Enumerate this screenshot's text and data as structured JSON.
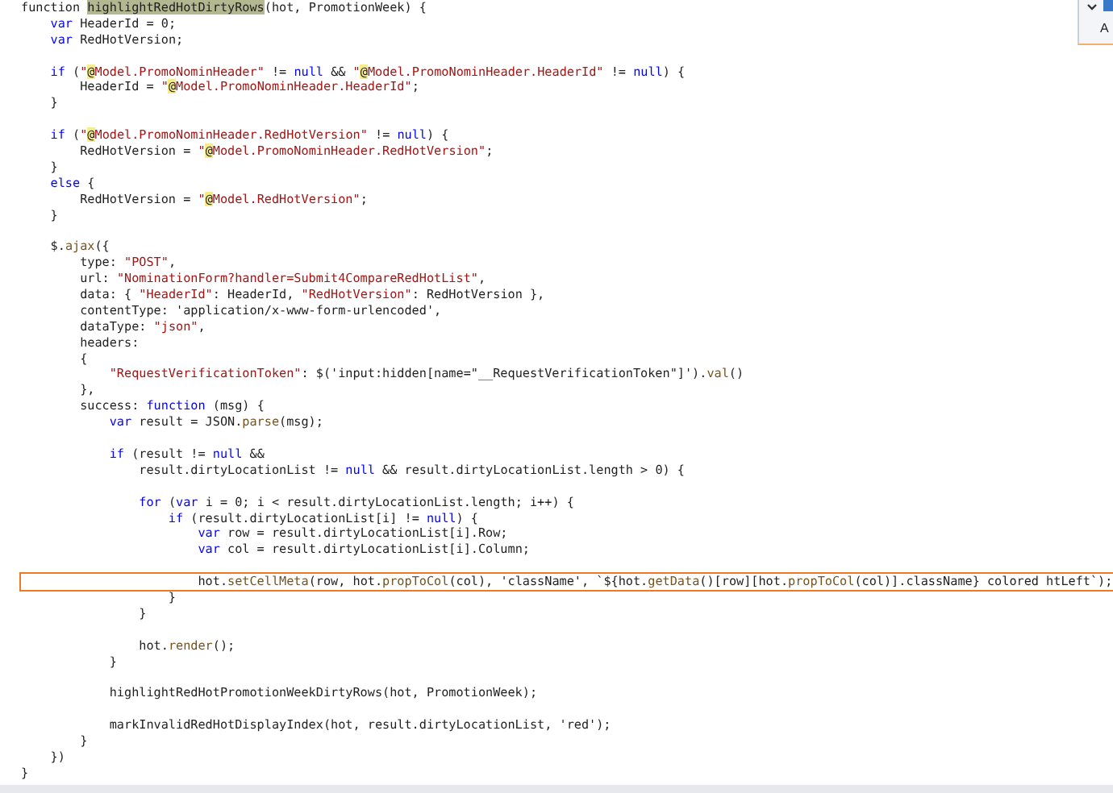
{
  "find_widget": {
    "option_label": "A"
  },
  "lines": [
    {
      "kind": "code",
      "boxed": false,
      "tokens": [
        {
          "text": "function ",
          "kind": "plain"
        },
        {
          "text": "highlightRedHotDirtyRows",
          "kind": "match"
        },
        {
          "text": "(hot, PromotionWeek) {",
          "kind": "plain"
        }
      ]
    },
    {
      "kind": "code",
      "boxed": false,
      "tokens": [
        {
          "text": "    var",
          "kind": "keyword"
        },
        {
          "text": " HeaderId = 0;",
          "kind": "plain"
        }
      ]
    },
    {
      "kind": "code",
      "boxed": false,
      "tokens": [
        {
          "text": "    var",
          "kind": "keyword"
        },
        {
          "text": " RedHotVersion;",
          "kind": "plain"
        }
      ]
    },
    {
      "kind": "blank"
    },
    {
      "kind": "code",
      "boxed": false,
      "tokens": [
        {
          "text": "    if",
          "kind": "keyword"
        },
        {
          "text": " (",
          "kind": "plain"
        },
        {
          "text": "\"",
          "kind": "string"
        },
        {
          "text": "@",
          "kind": "razor"
        },
        {
          "text": "Model.PromoNominHeader\"",
          "kind": "string"
        },
        {
          "text": " != ",
          "kind": "plain"
        },
        {
          "text": "null",
          "kind": "keyword"
        },
        {
          "text": " && ",
          "kind": "plain"
        },
        {
          "text": "\"",
          "kind": "string"
        },
        {
          "text": "@",
          "kind": "razor"
        },
        {
          "text": "Model.PromoNominHeader.HeaderId\"",
          "kind": "string"
        },
        {
          "text": " != ",
          "kind": "plain"
        },
        {
          "text": "null",
          "kind": "keyword"
        },
        {
          "text": ") {",
          "kind": "plain"
        }
      ]
    },
    {
      "kind": "code",
      "boxed": false,
      "tokens": [
        {
          "text": "        HeaderId = ",
          "kind": "plain"
        },
        {
          "text": "\"",
          "kind": "string"
        },
        {
          "text": "@",
          "kind": "razor"
        },
        {
          "text": "Model.PromoNominHeader.HeaderId\"",
          "kind": "string"
        },
        {
          "text": ";",
          "kind": "plain"
        }
      ]
    },
    {
      "kind": "code",
      "boxed": false,
      "tokens": [
        {
          "text": "    }",
          "kind": "plain"
        }
      ]
    },
    {
      "kind": "blank"
    },
    {
      "kind": "code",
      "boxed": false,
      "tokens": [
        {
          "text": "    if",
          "kind": "keyword"
        },
        {
          "text": " (",
          "kind": "plain"
        },
        {
          "text": "\"",
          "kind": "string"
        },
        {
          "text": "@",
          "kind": "razor"
        },
        {
          "text": "Model.PromoNominHeader.RedHotVersion\"",
          "kind": "string"
        },
        {
          "text": " != ",
          "kind": "plain"
        },
        {
          "text": "null",
          "kind": "keyword"
        },
        {
          "text": ") {",
          "kind": "plain"
        }
      ]
    },
    {
      "kind": "code",
      "boxed": false,
      "tokens": [
        {
          "text": "        RedHotVersion = ",
          "kind": "plain"
        },
        {
          "text": "\"",
          "kind": "string"
        },
        {
          "text": "@",
          "kind": "razor"
        },
        {
          "text": "Model.PromoNominHeader.RedHotVersion\"",
          "kind": "string"
        },
        {
          "text": ";",
          "kind": "plain"
        }
      ]
    },
    {
      "kind": "code",
      "boxed": false,
      "tokens": [
        {
          "text": "    }",
          "kind": "plain"
        }
      ]
    },
    {
      "kind": "code",
      "boxed": false,
      "tokens": [
        {
          "text": "    else",
          "kind": "keyword"
        },
        {
          "text": " {",
          "kind": "plain"
        }
      ]
    },
    {
      "kind": "code",
      "boxed": false,
      "tokens": [
        {
          "text": "        RedHotVersion = ",
          "kind": "plain"
        },
        {
          "text": "\"",
          "kind": "string"
        },
        {
          "text": "@",
          "kind": "razor"
        },
        {
          "text": "Model.RedHotVersion\"",
          "kind": "string"
        },
        {
          "text": ";",
          "kind": "plain"
        }
      ]
    },
    {
      "kind": "code",
      "boxed": false,
      "tokens": [
        {
          "text": "    }",
          "kind": "plain"
        }
      ]
    },
    {
      "kind": "blank"
    },
    {
      "kind": "code",
      "boxed": false,
      "tokens": [
        {
          "text": "    $.",
          "kind": "plain"
        },
        {
          "text": "ajax",
          "kind": "method"
        },
        {
          "text": "({",
          "kind": "plain"
        }
      ]
    },
    {
      "kind": "code",
      "boxed": false,
      "tokens": [
        {
          "text": "        type: ",
          "kind": "plain"
        },
        {
          "text": "\"POST\"",
          "kind": "string"
        },
        {
          "text": ",",
          "kind": "plain"
        }
      ]
    },
    {
      "kind": "code",
      "boxed": false,
      "tokens": [
        {
          "text": "        url: ",
          "kind": "plain"
        },
        {
          "text": "\"NominationForm?handler=Submit4CompareRedHotList\"",
          "kind": "string"
        },
        {
          "text": ",",
          "kind": "plain"
        }
      ]
    },
    {
      "kind": "code",
      "boxed": false,
      "tokens": [
        {
          "text": "        data: { ",
          "kind": "plain"
        },
        {
          "text": "\"HeaderId\"",
          "kind": "string"
        },
        {
          "text": ": HeaderId, ",
          "kind": "plain"
        },
        {
          "text": "\"RedHotVersion\"",
          "kind": "string"
        },
        {
          "text": ": RedHotVersion },",
          "kind": "plain"
        }
      ]
    },
    {
      "kind": "code",
      "boxed": false,
      "tokens": [
        {
          "text": "        contentType: 'application/x-www-form-urlencoded',",
          "kind": "plain"
        }
      ]
    },
    {
      "kind": "code",
      "boxed": false,
      "tokens": [
        {
          "text": "        dataType: ",
          "kind": "plain"
        },
        {
          "text": "\"json\"",
          "kind": "string"
        },
        {
          "text": ",",
          "kind": "plain"
        }
      ]
    },
    {
      "kind": "code",
      "boxed": false,
      "tokens": [
        {
          "text": "        headers:",
          "kind": "plain"
        }
      ]
    },
    {
      "kind": "code",
      "boxed": false,
      "tokens": [
        {
          "text": "        {",
          "kind": "plain"
        }
      ]
    },
    {
      "kind": "code",
      "boxed": false,
      "tokens": [
        {
          "text": "            \"RequestVerificationToken\"",
          "kind": "string"
        },
        {
          "text": ": $('input:hidden[name=\"__RequestVerificationToken\"]').",
          "kind": "plain"
        },
        {
          "text": "val",
          "kind": "method"
        },
        {
          "text": "()",
          "kind": "plain"
        }
      ]
    },
    {
      "kind": "code",
      "boxed": false,
      "tokens": [
        {
          "text": "        },",
          "kind": "plain"
        }
      ]
    },
    {
      "kind": "code",
      "boxed": false,
      "tokens": [
        {
          "text": "        success: ",
          "kind": "plain"
        },
        {
          "text": "function",
          "kind": "keyword"
        },
        {
          "text": " (msg) {",
          "kind": "plain"
        }
      ]
    },
    {
      "kind": "code",
      "boxed": false,
      "tokens": [
        {
          "text": "            var",
          "kind": "keyword"
        },
        {
          "text": " result = JSON.",
          "kind": "plain"
        },
        {
          "text": "parse",
          "kind": "method"
        },
        {
          "text": "(msg);",
          "kind": "plain"
        }
      ]
    },
    {
      "kind": "blank"
    },
    {
      "kind": "code",
      "boxed": false,
      "tokens": [
        {
          "text": "            if",
          "kind": "keyword"
        },
        {
          "text": " (result != ",
          "kind": "plain"
        },
        {
          "text": "null",
          "kind": "keyword"
        },
        {
          "text": " &&",
          "kind": "plain"
        }
      ]
    },
    {
      "kind": "code",
      "boxed": false,
      "tokens": [
        {
          "text": "                result.dirtyLocationList != ",
          "kind": "plain"
        },
        {
          "text": "null",
          "kind": "keyword"
        },
        {
          "text": " && result.dirtyLocationList.length > 0) {",
          "kind": "plain"
        }
      ]
    },
    {
      "kind": "blank"
    },
    {
      "kind": "code",
      "boxed": false,
      "tokens": [
        {
          "text": "                for",
          "kind": "keyword"
        },
        {
          "text": " (",
          "kind": "plain"
        },
        {
          "text": "var",
          "kind": "keyword"
        },
        {
          "text": " i = 0; i < result.dirtyLocationList.length; i++) {",
          "kind": "plain"
        }
      ]
    },
    {
      "kind": "code",
      "boxed": false,
      "tokens": [
        {
          "text": "                    if",
          "kind": "keyword"
        },
        {
          "text": " (result.dirtyLocationList[i] != ",
          "kind": "plain"
        },
        {
          "text": "null",
          "kind": "keyword"
        },
        {
          "text": ") {",
          "kind": "plain"
        }
      ]
    },
    {
      "kind": "code",
      "boxed": false,
      "tokens": [
        {
          "text": "                        var",
          "kind": "keyword"
        },
        {
          "text": " row = result.dirtyLocationList[i].Row;",
          "kind": "plain"
        }
      ]
    },
    {
      "kind": "code",
      "boxed": false,
      "tokens": [
        {
          "text": "                        var",
          "kind": "keyword"
        },
        {
          "text": " col = result.dirtyLocationList[i].Column;",
          "kind": "plain"
        }
      ]
    },
    {
      "kind": "blank"
    },
    {
      "kind": "code",
      "boxed": true,
      "tokens": [
        {
          "text": "                        hot.",
          "kind": "plain"
        },
        {
          "text": "setCellMeta",
          "kind": "method"
        },
        {
          "text": "(row, hot.",
          "kind": "plain"
        },
        {
          "text": "propToCol",
          "kind": "method"
        },
        {
          "text": "(col), 'className', `${hot.",
          "kind": "plain"
        },
        {
          "text": "getData",
          "kind": "method"
        },
        {
          "text": "()[row][hot.",
          "kind": "plain"
        },
        {
          "text": "propToCol",
          "kind": "method"
        },
        {
          "text": "(col)].className} colored htLeft`);",
          "kind": "plain"
        }
      ]
    },
    {
      "kind": "code",
      "boxed": false,
      "tokens": [
        {
          "text": "                    }",
          "kind": "plain"
        }
      ]
    },
    {
      "kind": "code",
      "boxed": false,
      "tokens": [
        {
          "text": "                }",
          "kind": "plain"
        }
      ]
    },
    {
      "kind": "blank"
    },
    {
      "kind": "code",
      "boxed": false,
      "tokens": [
        {
          "text": "                hot.",
          "kind": "plain"
        },
        {
          "text": "render",
          "kind": "method"
        },
        {
          "text": "();",
          "kind": "plain"
        }
      ]
    },
    {
      "kind": "code",
      "boxed": false,
      "tokens": [
        {
          "text": "            }",
          "kind": "plain"
        }
      ]
    },
    {
      "kind": "blank"
    },
    {
      "kind": "code",
      "boxed": false,
      "tokens": [
        {
          "text": "            highlightRedHotPromotionWeekDirtyRows(hot, PromotionWeek);",
          "kind": "plain"
        }
      ]
    },
    {
      "kind": "blank"
    },
    {
      "kind": "code",
      "boxed": false,
      "tokens": [
        {
          "text": "            markInvalidRedHotDisplayIndex(hot, result.dirtyLocationList, 'red');",
          "kind": "plain"
        }
      ]
    },
    {
      "kind": "code",
      "boxed": false,
      "tokens": [
        {
          "text": "        }",
          "kind": "plain"
        }
      ]
    },
    {
      "kind": "code",
      "boxed": false,
      "tokens": [
        {
          "text": "    })",
          "kind": "plain"
        }
      ]
    },
    {
      "kind": "code",
      "boxed": false,
      "tokens": [
        {
          "text": "}",
          "kind": "plain"
        }
      ]
    }
  ]
}
